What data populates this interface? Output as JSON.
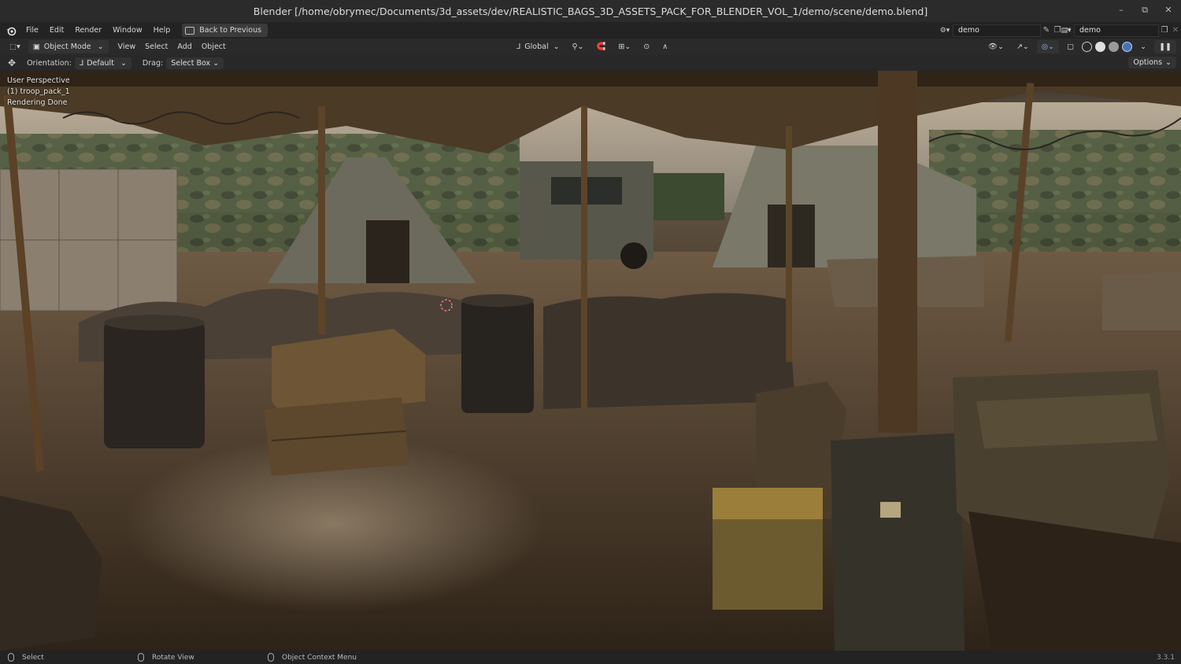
{
  "window": {
    "title": "Blender [/home/obrymec/Documents/3d_assets/dev/REALISTIC_BAGS_3D_ASSETS_PACK_FOR_BLENDER_VOL_1/demo/scene/demo.blend]",
    "controls": [
      "–",
      "⧉",
      "✕"
    ]
  },
  "menu": {
    "items": [
      "File",
      "Edit",
      "Render",
      "Window",
      "Help"
    ],
    "back_label": "Back to Previous",
    "scene_name": "demo",
    "view_layer": "demo"
  },
  "header": {
    "mode": "Object Mode",
    "menus": [
      "View",
      "Select",
      "Add",
      "Object"
    ],
    "transform": "Global"
  },
  "tool_settings": {
    "orientation_label": "Orientation:",
    "orientation_value": "Default",
    "drag_label": "Drag:",
    "drag_value": "Select Box",
    "options_label": "Options"
  },
  "viewport": {
    "overlay": [
      "User Perspective",
      "(1) troop_pack_1",
      "Rendering Done"
    ]
  },
  "status": {
    "select": "Select",
    "rotate": "Rotate View",
    "context": "Object Context Menu",
    "version": "3.3.1"
  },
  "colors": {
    "accent": "#4772b3",
    "panel": "#2a2a2a"
  }
}
